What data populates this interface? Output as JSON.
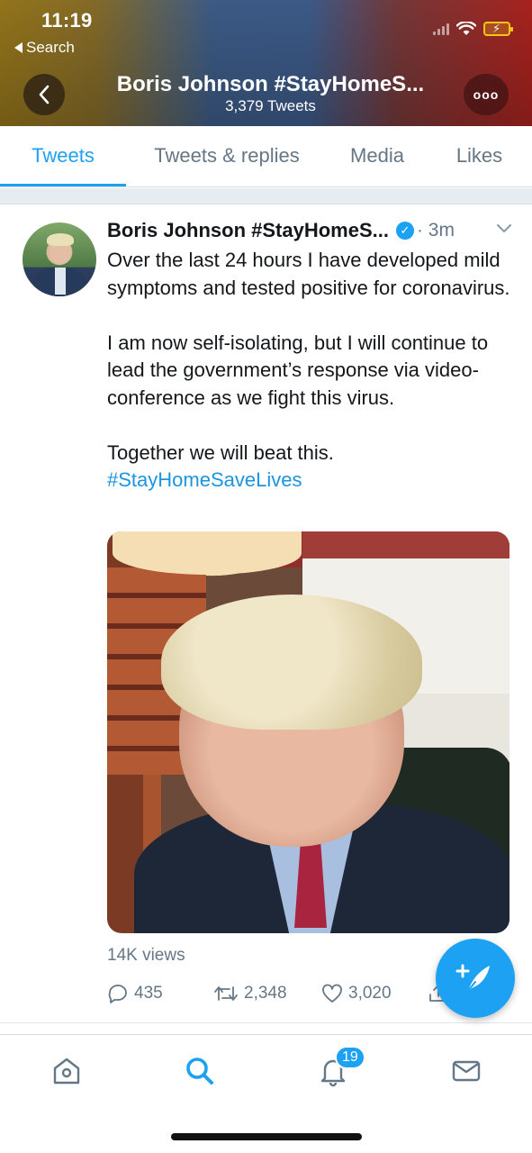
{
  "status_bar": {
    "time": "11:19",
    "back_label": "Search"
  },
  "header": {
    "title": "Boris Johnson #StayHomeS...",
    "subtitle": "3,379 Tweets",
    "more_label": "ooo"
  },
  "tabs": [
    {
      "label": "Tweets",
      "active": true
    },
    {
      "label": "Tweets & replies",
      "active": false
    },
    {
      "label": "Media",
      "active": false
    },
    {
      "label": "Likes",
      "active": false
    }
  ],
  "tweet": {
    "author_name": "Boris Johnson #StayHomeS...",
    "verified": true,
    "time": "· 3m",
    "paragraphs": [
      "Over the last 24 hours I have developed mild symptoms and tested positive for coronavirus.",
      "I am now self-isolating, but I will continue to lead the government’s response via video-conference as we fight this virus.",
      "Together we will beat this."
    ],
    "hashtag": "#StayHomeSaveLives",
    "views": "14K views",
    "replies": "435",
    "retweets": "2,348",
    "likes": "3,020"
  },
  "bottom_nav": {
    "items": [
      "home-icon",
      "search-icon",
      "notifications-icon",
      "messages-icon"
    ],
    "notification_count": "19",
    "active": "search-icon"
  },
  "colors": {
    "accent": "#1da1f2",
    "text": "#14171a",
    "secondary": "#657786"
  }
}
